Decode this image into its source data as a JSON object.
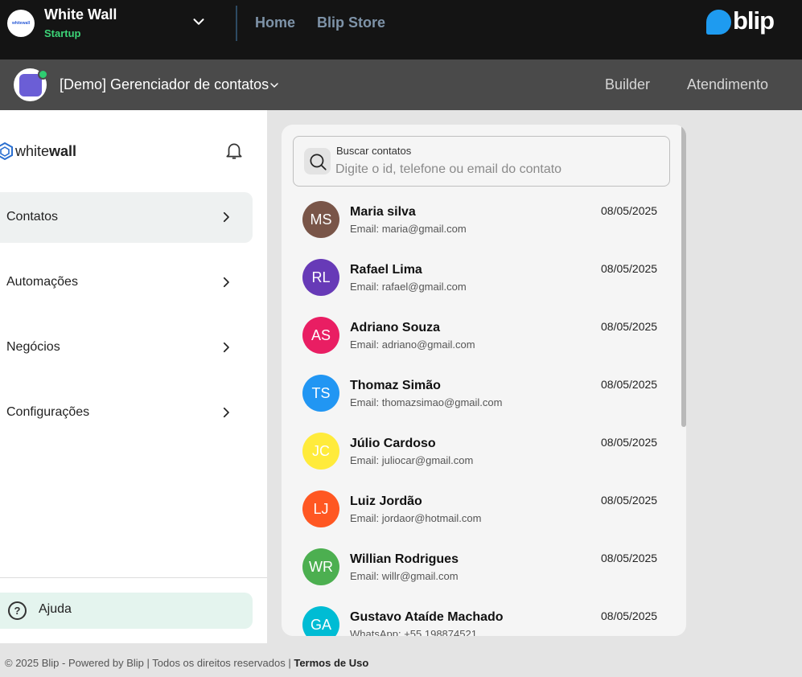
{
  "org": {
    "name": "White Wall",
    "plan": "Startup",
    "logo_text": "whitewall"
  },
  "topnav": {
    "home": "Home",
    "store": "Blip Store",
    "brand": "blip"
  },
  "bot": {
    "name": "[Demo] Gerenciador de contatos",
    "nav_builder": "Builder",
    "nav_atendimento": "Atendimento"
  },
  "sidebar": {
    "logo_light": "white",
    "logo_bold": "wall",
    "items": [
      {
        "label": "Contatos",
        "active": true
      },
      {
        "label": "Automações",
        "active": false
      },
      {
        "label": "Negócios",
        "active": false
      },
      {
        "label": "Configurações",
        "active": false
      }
    ],
    "help": "Ajuda"
  },
  "search": {
    "label": "Buscar contatos",
    "placeholder": "Digite o id, telefone ou email do contato",
    "value": ""
  },
  "contacts": [
    {
      "initials": "MS",
      "name": "Maria silva",
      "detail": "Email: maria@gmail.com",
      "date": "08/05/2025",
      "color": "#795548"
    },
    {
      "initials": "RL",
      "name": "Rafael Lima",
      "detail": "Email: rafael@gmail.com",
      "date": "08/05/2025",
      "color": "#673ab7"
    },
    {
      "initials": "AS",
      "name": "Adriano Souza",
      "detail": "Email: adriano@gmail.com",
      "date": "08/05/2025",
      "color": "#e91e63"
    },
    {
      "initials": "TS",
      "name": "Thomaz Simão",
      "detail": "Email: thomazsimao@gmail.com",
      "date": "08/05/2025",
      "color": "#2196f3"
    },
    {
      "initials": "JC",
      "name": "Júlio Cardoso",
      "detail": "Email: juliocar@gmail.com",
      "date": "08/05/2025",
      "color": "#ffeb3b"
    },
    {
      "initials": "LJ",
      "name": "Luiz Jordão",
      "detail": "Email: jordaor@hotmail.com",
      "date": "08/05/2025",
      "color": "#ff5722"
    },
    {
      "initials": "WR",
      "name": "Willian Rodrigues",
      "detail": "Email: willr@gmail.com",
      "date": "08/05/2025",
      "color": "#4caf50"
    },
    {
      "initials": "GA",
      "name": "Gustavo Ataíde Machado",
      "detail": "WhatsApp: +55 198874521",
      "date": "08/05/2025",
      "color": "#00bcd4"
    }
  ],
  "footer": {
    "text": "© 2025 Blip - Powered by Blip | Todos os direitos reservados |",
    "link": "Termos de Uso"
  }
}
